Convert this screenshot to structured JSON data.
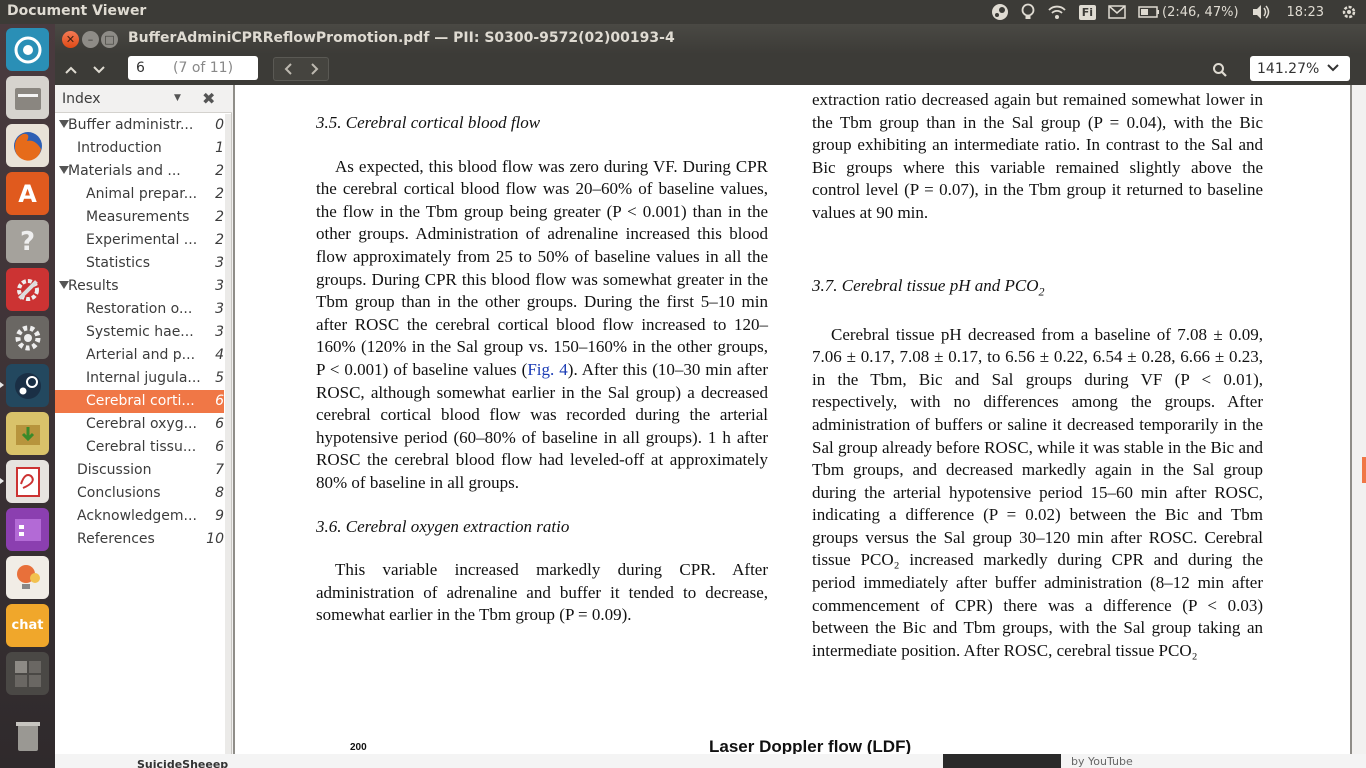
{
  "top_panel": {
    "app_title": "Document Viewer",
    "battery": "(2:46, 47%)",
    "keyboard": "Fi",
    "time": "18:23"
  },
  "window": {
    "title": "BufferAdminiCPRReflowPromotion.pdf — PII: S0300-9572(02)00193-4"
  },
  "toolbar": {
    "page_value": "6",
    "page_of": "(7 of 11)",
    "zoom": "141.27%"
  },
  "sidebar": {
    "header": "Index",
    "items": [
      {
        "label": "Buffer administr...",
        "page": "0",
        "level": 0,
        "expanded": true
      },
      {
        "label": "Introduction",
        "page": "1",
        "level": 1
      },
      {
        "label": "Materials and ...",
        "page": "2",
        "level": 0,
        "expanded": true
      },
      {
        "label": "Animal prepar...",
        "page": "2",
        "level": 2
      },
      {
        "label": "Measurements",
        "page": "2",
        "level": 2
      },
      {
        "label": "Experimental ...",
        "page": "2",
        "level": 2
      },
      {
        "label": "Statistics",
        "page": "3",
        "level": 2
      },
      {
        "label": "Results",
        "page": "3",
        "level": 0,
        "expanded": true
      },
      {
        "label": "Restoration o...",
        "page": "3",
        "level": 2
      },
      {
        "label": "Systemic hae...",
        "page": "3",
        "level": 2
      },
      {
        "label": "Arterial and p...",
        "page": "4",
        "level": 2
      },
      {
        "label": "Internal jugula...",
        "page": "5",
        "level": 2
      },
      {
        "label": "Cerebral corti...",
        "page": "6",
        "level": 2,
        "selected": true
      },
      {
        "label": "Cerebral oxyg...",
        "page": "6",
        "level": 2
      },
      {
        "label": "Cerebral tissu...",
        "page": "6",
        "level": 2
      },
      {
        "label": "Discussion",
        "page": "7",
        "level": 1
      },
      {
        "label": "Conclusions",
        "page": "8",
        "level": 1
      },
      {
        "label": "Acknowledgem...",
        "page": "9",
        "level": 1
      },
      {
        "label": "References",
        "page": "10",
        "level": 1
      }
    ]
  },
  "document": {
    "left": {
      "h35": "3.5.  Cerebral cortical blood flow",
      "p35a": "As expected, this blood flow was zero during VF. During CPR the cerebral cortical blood flow was 20–60% of baseline values, the flow in the Tbm group being greater (P < 0.001) than in the other groups. Administration of adrenaline increased this blood flow approximately from 25 to 50% of baseline values in all the groups. During CPR this blood flow was somewhat greater in the Tbm group than in the other groups. During the first 5–10 min after ROSC the cerebral cortical blood flow increased to 120–160% (120% in the Sal group vs. 150–160% in the other groups, P < 0.001) of baseline values (",
      "fig_link": "Fig. 4",
      "p35b": "). After this (10–30 min after ROSC, although somewhat earlier in the Sal group) a decreased cerebral cortical blood flow was recorded during the arterial hypotensive period (60–80% of baseline in all groups). 1 h after ROSC the cerebral blood flow had leveled-off at approximately 80% of baseline in all groups.",
      "h36": "3.6.  Cerebral oxygen extraction ratio",
      "p36": "This variable increased markedly during CPR. After administration of adrenaline and buffer it tended to decrease, somewhat earlier in the Tbm group (P = 0.09)."
    },
    "right": {
      "p_cont": "extraction ratio decreased again but remained somewhat lower in the Tbm group than in the Sal group (P = 0.04), with the Bic group exhibiting an intermediate ratio. In contrast to the Sal and Bic groups where this variable remained slightly above the control level (P = 0.07), in the Tbm group it returned to baseline values at 90 min.",
      "h37": "3.7.  Cerebral tissue pH and PCO",
      "h37_sub": "2",
      "p37": "Cerebral tissue pH decreased from a baseline of 7.08 ± 0.09, 7.06 ± 0.17, 7.08 ± 0.17, to 6.56 ± 0.22, 6.54 ± 0.28, 6.66 ± 0.23, in the Tbm, Bic and Sal groups during VF (P < 0.01), respectively, with no differences among the groups. After administration of buffers or saline it decreased temporarily in the Sal group already before ROSC, while it was stable in the Bic and Tbm groups, and decreased markedly again in the Sal group during the arterial hypotensive period 15–60 min after ROSC, indicating a difference (P = 0.02) between the Bic and Tbm groups versus the Sal group 30–120 min after ROSC. Cerebral tissue PCO₂ increased markedly during CPR and during the period immediately after buffer administration (8–12 min after commencement of CPR) there was a difference (P < 0.03) between the Bic and Tbm groups, with the Sal group taking an intermediate position. After ROSC, cerebral tissue PCO₂"
    },
    "figure_title": "Laser Doppler flow (LDF)",
    "figure_axis_top": "200"
  },
  "desktop_strip": {
    "left_text": "SuicideSheeep",
    "right_text": "by YouTube"
  },
  "colors": {
    "accent": "#f07746",
    "panel": "#3c3b37",
    "link": "#1a3bb5"
  }
}
